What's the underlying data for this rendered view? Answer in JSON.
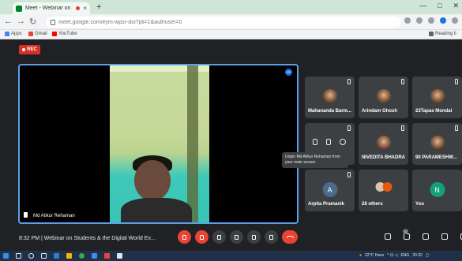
{
  "browser": {
    "tab_title": "Meet - Webinar on Studen",
    "tab_close": "×",
    "new_tab": "+",
    "url": "meet.google.com/eym-wpsr-doi?pli=1&authuser=0",
    "bookmarks": [
      {
        "label": "Apps",
        "color": "#4285f4"
      },
      {
        "label": "Gmail",
        "color": "#ea4335"
      },
      {
        "label": "YouTube",
        "color": "#ff0000"
      }
    ],
    "reading_list": "Reading li"
  },
  "meeting": {
    "rec_label": "REC",
    "main_participant": "Md Atikur Rehaman",
    "tooltip": "Unpin Md Atikur Rehaman from your main screen",
    "time": "8:32 PM",
    "title": "Webinar on Students & the Digital World Ex...",
    "people_count": "32"
  },
  "participants": [
    {
      "name": "Mahananda Barm...",
      "avatar": "pic"
    },
    {
      "name": "Arindam Ghosh",
      "avatar": "pic"
    },
    {
      "name": "23Tapas Mondal",
      "avatar": "pic"
    },
    {
      "name": "",
      "avatar": "hover"
    },
    {
      "name": "NIVEDITA BHADRA",
      "avatar": "pic"
    },
    {
      "name": "90 PARAMESHW...",
      "avatar": "pic"
    },
    {
      "name": "Arpita Pramanik",
      "avatar": "letter",
      "letter": "A",
      "color": "#4a6b8a"
    },
    {
      "name": "28 others",
      "avatar": "others"
    },
    {
      "name": "You",
      "avatar": "letter",
      "letter": "N",
      "color": "#12a07a"
    }
  ],
  "taskbar": {
    "weather": "22°C Haze",
    "lang": "ENG",
    "time": "20:32"
  }
}
